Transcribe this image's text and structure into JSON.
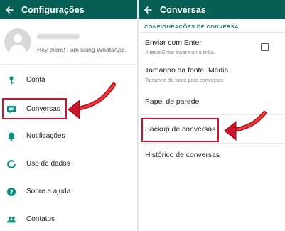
{
  "colors": {
    "appbar": "#075e54",
    "accent": "#2e7d73",
    "highlight": "#c8162a",
    "icon_teal": "#0b8f7f"
  },
  "left_panel": {
    "title": "Configurações",
    "profile": {
      "status": "Hey there! I am using WhatsApp."
    },
    "menu": [
      {
        "label": "Conta",
        "icon": "key-icon"
      },
      {
        "label": "Conversas",
        "icon": "chat-icon"
      },
      {
        "label": "Notificações",
        "icon": "bell-icon"
      },
      {
        "label": "Uso de dados",
        "icon": "data-usage-icon"
      },
      {
        "label": "Sobre e ajuda",
        "icon": "help-icon"
      },
      {
        "label": "Contatos",
        "icon": "contacts-icon"
      }
    ]
  },
  "right_panel": {
    "title": "Conversas",
    "section_header": "CONFIGURAÇÕES DE CONVERSA",
    "settings": [
      {
        "title": "Enviar com Enter",
        "subtitle": "A tecla Enter insere uma linha"
      },
      {
        "title": "Tamanho da fonte: Média",
        "subtitle": "Tamanho da fonte para conversas"
      },
      {
        "title": "Papel de parede"
      },
      {
        "title": "Backup de conversas"
      },
      {
        "title": "Histórico de conversas"
      }
    ]
  }
}
